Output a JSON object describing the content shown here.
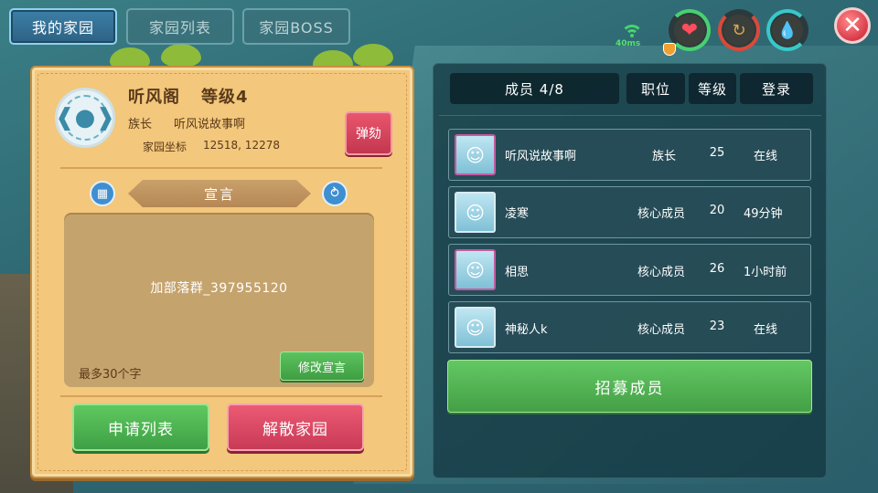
{
  "tabs": [
    {
      "label": "我的家园",
      "active": true
    },
    {
      "label": "家园列表",
      "active": false
    },
    {
      "label": "家园BOSS",
      "active": false
    }
  ],
  "status": {
    "ping": "40ms",
    "icons": [
      "signal-icon",
      "heart-icon",
      "strength-icon",
      "water-drop-icon",
      "close-icon"
    ]
  },
  "home": {
    "name": "听风阁",
    "level": "等级4",
    "leader_role": "族长",
    "leader_name": "听风说故事啊",
    "coord_label": "家园坐标",
    "coord_value": "12518, 12278",
    "impeach_label": "弹劾",
    "declaration_title": "宣言",
    "declaration_text": "加部落群_397955120",
    "max_chars": "最多30个字",
    "edit_declaration": "修改宣言",
    "apply_list": "申请列表",
    "disband": "解散家园"
  },
  "members_panel": {
    "header_count": "成员 4/8",
    "header_position": "职位",
    "header_level": "等级",
    "header_login": "登录",
    "recruit": "招募成员",
    "members": [
      {
        "name": "听风说故事啊",
        "role": "族长",
        "level": "25",
        "login": "在线"
      },
      {
        "name": "凌寒",
        "role": "核心成员",
        "level": "20",
        "login": "49分钟"
      },
      {
        "name": "相思",
        "role": "核心成员",
        "level": "26",
        "login": "1小时前"
      },
      {
        "name": "神秘人k",
        "role": "核心成员",
        "level": "23",
        "login": "在线"
      }
    ]
  },
  "colors": {
    "parchment": "#f3c77c",
    "green_button": "#4fb352",
    "red_button": "#d8465e",
    "panel_dark": "#12343e"
  }
}
